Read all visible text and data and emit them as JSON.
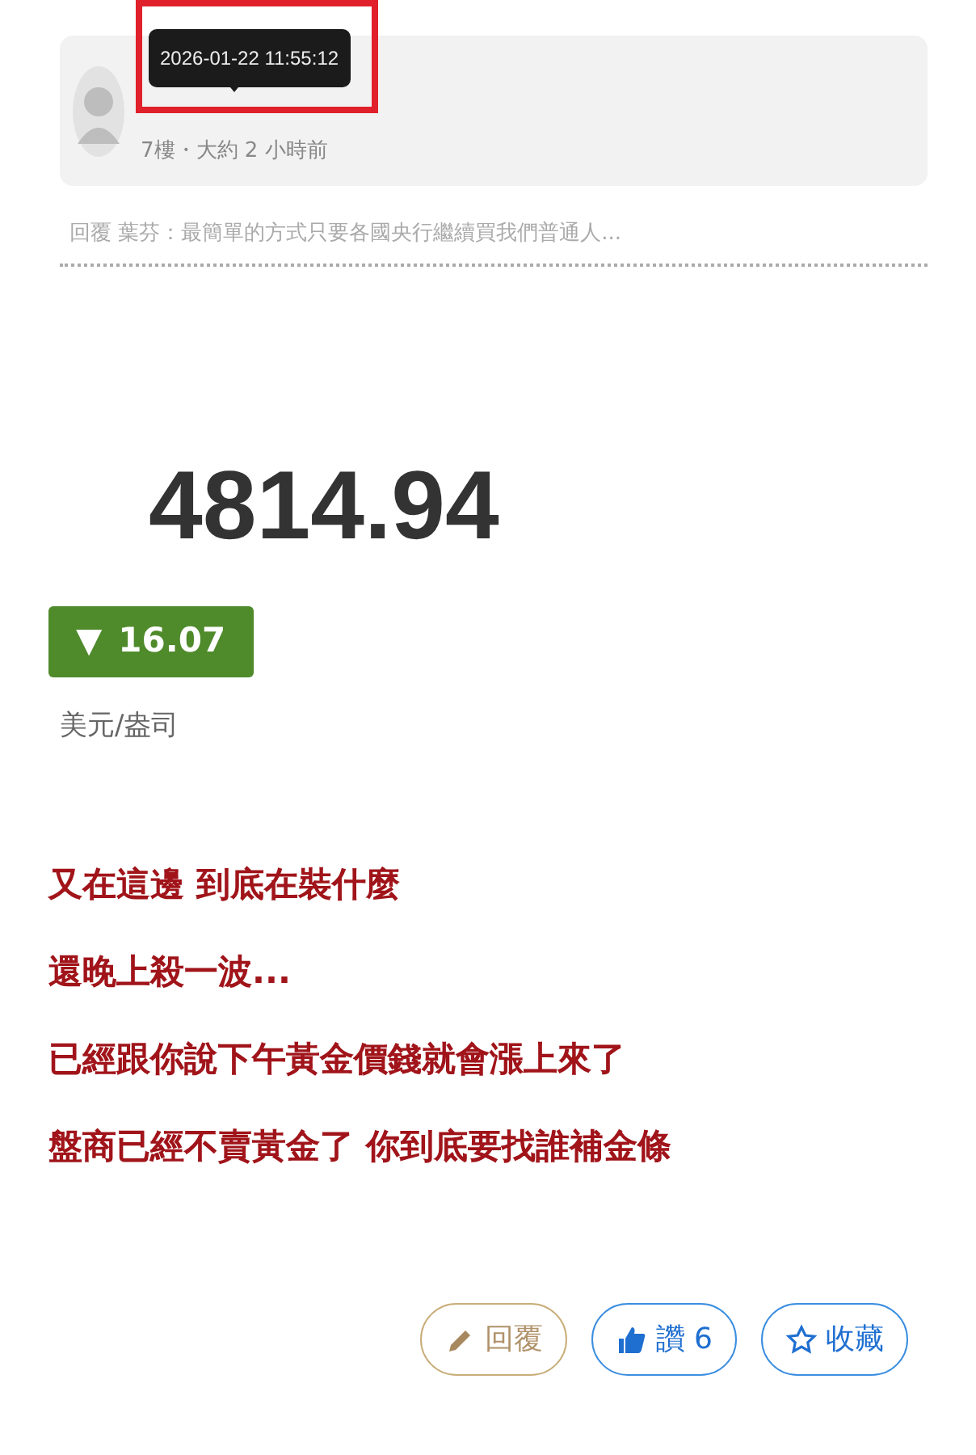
{
  "quoted_post": {
    "tooltip": "2026-01-22 11:55:12",
    "meta": "7樓・大約 2 小時前",
    "reply_preview": "回覆 葉芬：最簡單的方式只要各國央行繼續買我們普通人..."
  },
  "quote": {
    "price": "4814.94",
    "change": {
      "arrow": "▼",
      "value": "16.07"
    },
    "unit": "美元/盎司"
  },
  "comments": [
    "又在這邊 到底在裝什麼",
    "還晚上殺一波...",
    "已經跟你說下午黃金價錢就會漲上來了",
    "盤商已經不賣黃金了 你到底要找誰補金條"
  ],
  "actions": [
    {
      "kind": "reply",
      "label": "回覆"
    },
    {
      "kind": "like",
      "label": "讚 6"
    },
    {
      "kind": "favorite",
      "label": "收藏"
    }
  ]
}
